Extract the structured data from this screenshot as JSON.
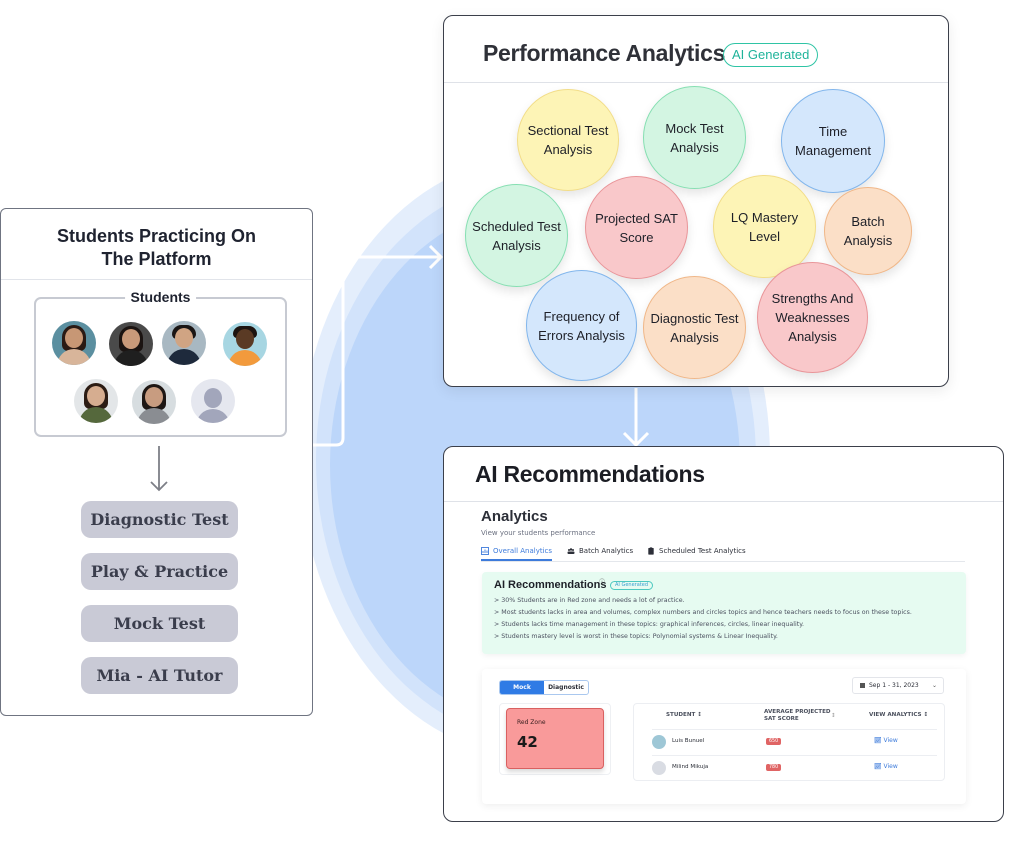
{
  "left_panel": {
    "title_line1": "Students Practicing On",
    "title_line2": "The Platform",
    "students_label": "Students",
    "avatars": [
      {
        "name": "student-avatar-1",
        "placeholder": false
      },
      {
        "name": "student-avatar-2",
        "placeholder": false
      },
      {
        "name": "student-avatar-3",
        "placeholder": false
      },
      {
        "name": "student-avatar-4",
        "placeholder": false
      },
      {
        "name": "student-avatar-5",
        "placeholder": false
      },
      {
        "name": "student-avatar-6",
        "placeholder": false
      },
      {
        "name": "student-avatar-default",
        "placeholder": true
      }
    ],
    "steps": [
      "Diagnostic Test",
      "Play & Practice",
      "Mock Test",
      "Mia - AI Tutor"
    ]
  },
  "performance_analytics": {
    "title": "Performance Analytics",
    "badge": "AI Generated",
    "bubbles": [
      {
        "label_1": "Sectional Test",
        "label_2": "Analysis",
        "label_3": "",
        "color": "yellow"
      },
      {
        "label_1": "Mock Test",
        "label_2": "Analysis",
        "label_3": "",
        "color": "green"
      },
      {
        "label_1": "Time",
        "label_2": "Management",
        "label_3": "",
        "color": "blue"
      },
      {
        "label_1": "Scheduled Test",
        "label_2": "Analysis",
        "label_3": "",
        "color": "green"
      },
      {
        "label_1": "Projected SAT",
        "label_2": "Score",
        "label_3": "",
        "color": "red"
      },
      {
        "label_1": "LQ Mastery",
        "label_2": "Level",
        "label_3": "",
        "color": "yellow"
      },
      {
        "label_1": "Batch",
        "label_2": "Analysis",
        "label_3": "",
        "color": "orange"
      },
      {
        "label_1": "Frequency of",
        "label_2": "Errors Analysis",
        "label_3": "",
        "color": "blue"
      },
      {
        "label_1": "Diagnostic Test",
        "label_2": "Analysis",
        "label_3": "",
        "color": "orange"
      },
      {
        "label_1": "Strengths And",
        "label_2": "Weaknesses",
        "label_3": "Analysis",
        "color": "red"
      }
    ]
  },
  "ai_recommendations_panel": {
    "title": "AI Recommendations",
    "analytics_title": "Analytics",
    "analytics_subtitle": "View your students performance",
    "tabs": [
      {
        "label": "Overall Analytics",
        "active": true
      },
      {
        "label": "Batch Analytics",
        "active": false
      },
      {
        "label": "Scheduled Test Analytics",
        "active": false
      }
    ],
    "ai_box": {
      "title": "AI Recommendations",
      "info_glyph": "ⓘ",
      "badge": "AI Generated",
      "lines": [
        "> 30% Students are in Red zone and needs a lot of practice.",
        "> Most students lacks in area and volumes, complex numbers and circles topics and hence teachers needs to focus on these topics.",
        "> Students lacks time management in these topics: graphical inferences, circles, linear inequality.",
        "> Students mastery level  is worst in these topics:  Polynomial systems & Linear Inequality."
      ]
    },
    "toggle": {
      "options": [
        "Mock",
        "Diagnostic"
      ],
      "selected": "Mock"
    },
    "date_range": "Sep 1 - 31, 2023",
    "zone": {
      "label": "Red Zone",
      "value": "42"
    },
    "table": {
      "headers": {
        "student": "STUDENT ↕",
        "score_1": "AVERAGE PROJECTED",
        "score_2": "SAT SCORE",
        "score_sort": "↕",
        "view": "VIEW ANALYTICS ↕"
      },
      "rows": [
        {
          "student": "Luis Bunuel",
          "score": "650",
          "action": "View"
        },
        {
          "student": "Milind Mikuja",
          "score": "780",
          "action": "View"
        }
      ]
    }
  },
  "colors": {
    "accent_blue": "#2f7be5",
    "ai_badge_teal": "#1fb39a",
    "red_zone": "#f99a9a",
    "background_glow": "#bcd6fa"
  }
}
